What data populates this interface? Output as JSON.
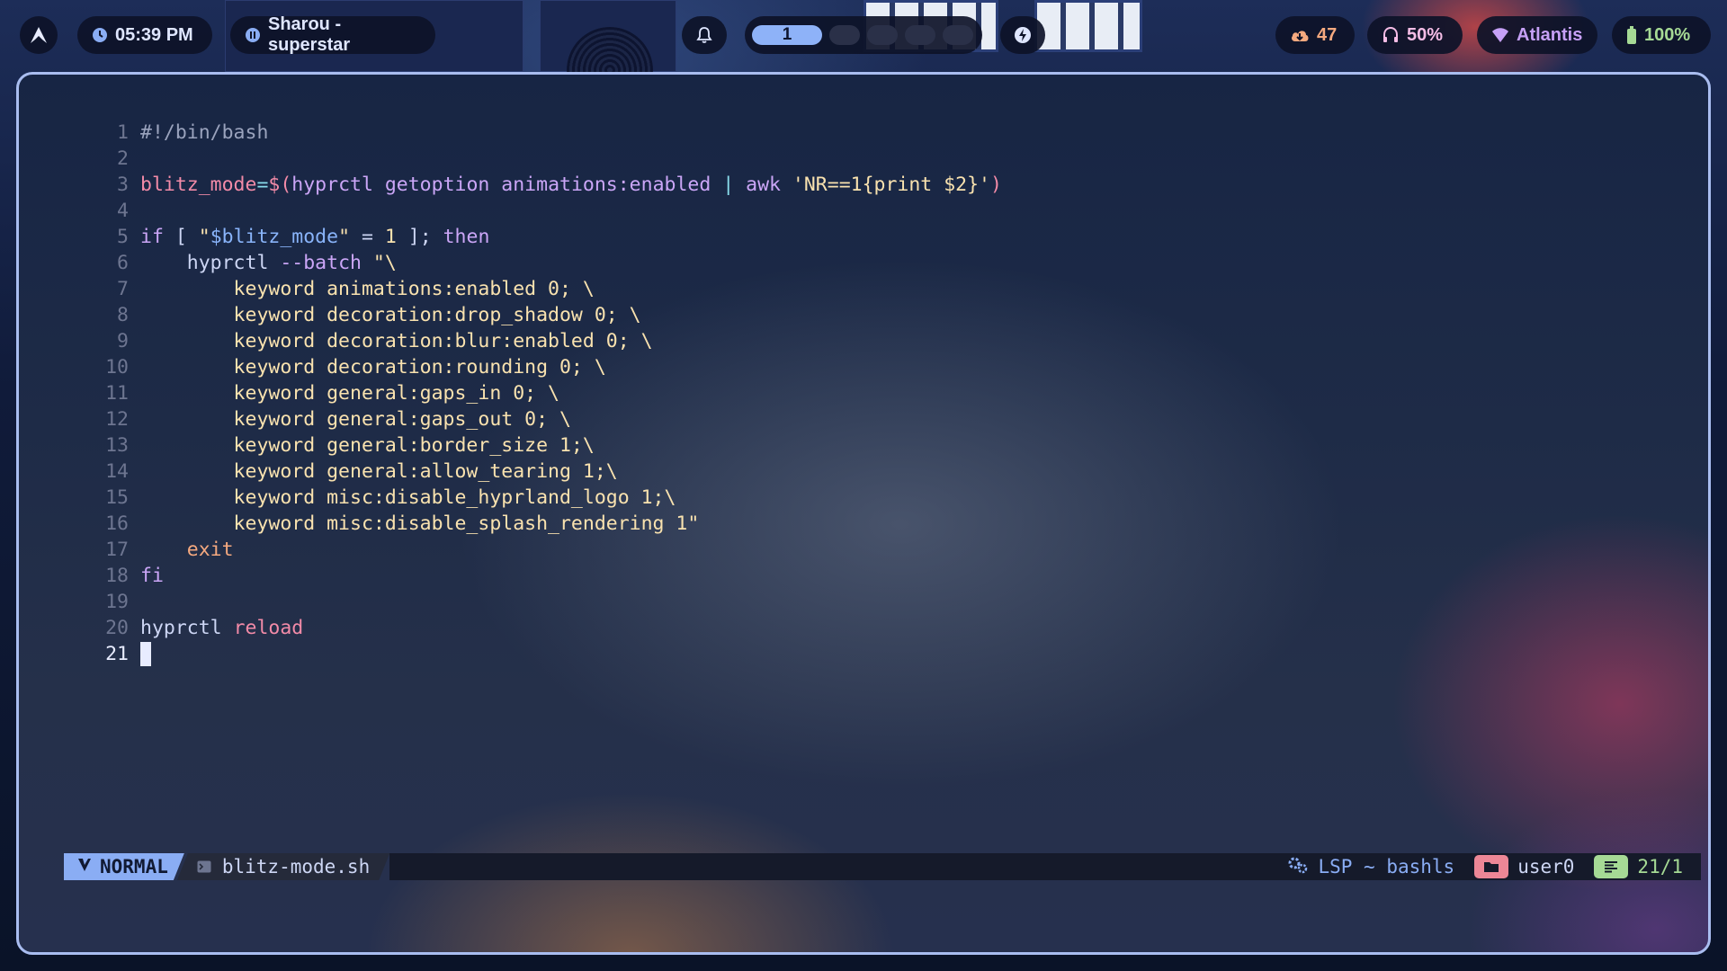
{
  "topbar": {
    "clock": "05:39 PM",
    "media": "Sharou - superstar",
    "workspace_active": "1",
    "updates": "47",
    "volume": "50%",
    "network": "Atlantis",
    "battery": "100%"
  },
  "editor": {
    "lines": [
      {
        "n": "1",
        "parts": [
          {
            "c": "t-cmt",
            "t": "#!/bin/bash"
          }
        ]
      },
      {
        "n": "2",
        "parts": []
      },
      {
        "n": "3",
        "parts": [
          {
            "c": "t-var",
            "t": "blitz_mode"
          },
          {
            "c": "t-op",
            "t": "="
          },
          {
            "c": "t-var",
            "t": "$("
          },
          {
            "c": "t-kw",
            "t": "hyprctl getoption animations:enabled "
          },
          {
            "c": "t-op",
            "t": "|"
          },
          {
            "c": "t-kw",
            "t": " awk "
          },
          {
            "c": "t-str",
            "t": "'NR==1{print $2}'"
          },
          {
            "c": "t-var",
            "t": ")"
          }
        ]
      },
      {
        "n": "4",
        "parts": []
      },
      {
        "n": "5",
        "parts": [
          {
            "c": "t-kw",
            "t": "if"
          },
          {
            "c": "t-def",
            "t": " [ "
          },
          {
            "c": "t-str",
            "t": "\""
          },
          {
            "c": "t-strvar",
            "t": "$blitz_mode"
          },
          {
            "c": "t-str",
            "t": "\""
          },
          {
            "c": "t-def",
            "t": " = "
          },
          {
            "c": "t-str",
            "t": "1"
          },
          {
            "c": "t-def",
            "t": " ]; "
          },
          {
            "c": "t-kw",
            "t": "then"
          }
        ]
      },
      {
        "n": "6",
        "parts": [
          {
            "c": "t-def",
            "t": "    hyprctl "
          },
          {
            "c": "t-kw",
            "t": "--batch"
          },
          {
            "c": "t-str",
            "t": " \"\\"
          }
        ]
      },
      {
        "n": "7",
        "parts": [
          {
            "c": "t-str",
            "t": "        keyword animations:enabled 0; \\"
          }
        ]
      },
      {
        "n": "8",
        "parts": [
          {
            "c": "t-str",
            "t": "        keyword decoration:drop_shadow 0; \\"
          }
        ]
      },
      {
        "n": "9",
        "parts": [
          {
            "c": "t-str",
            "t": "        keyword decoration:blur:enabled 0; \\"
          }
        ]
      },
      {
        "n": "10",
        "parts": [
          {
            "c": "t-str",
            "t": "        keyword decoration:rounding 0; \\"
          }
        ]
      },
      {
        "n": "11",
        "parts": [
          {
            "c": "t-str",
            "t": "        keyword general:gaps_in 0; \\"
          }
        ]
      },
      {
        "n": "12",
        "parts": [
          {
            "c": "t-str",
            "t": "        keyword general:gaps_out 0; \\"
          }
        ]
      },
      {
        "n": "13",
        "parts": [
          {
            "c": "t-str",
            "t": "        keyword general:border_size 1;\\"
          }
        ]
      },
      {
        "n": "14",
        "parts": [
          {
            "c": "t-str",
            "t": "        keyword general:allow_tearing 1;\\"
          }
        ]
      },
      {
        "n": "15",
        "parts": [
          {
            "c": "t-str",
            "t": "        keyword misc:disable_hyprland_logo 1;\\"
          }
        ]
      },
      {
        "n": "16",
        "parts": [
          {
            "c": "t-str",
            "t": "        keyword misc:disable_splash_rendering 1\""
          }
        ]
      },
      {
        "n": "17",
        "parts": [
          {
            "c": "t-exit",
            "t": "    exit"
          }
        ]
      },
      {
        "n": "18",
        "parts": [
          {
            "c": "t-kw",
            "t": "fi"
          }
        ]
      },
      {
        "n": "19",
        "parts": []
      },
      {
        "n": "20",
        "parts": [
          {
            "c": "t-plain",
            "t": "hyprctl "
          },
          {
            "c": "t-pink",
            "t": "reload"
          }
        ]
      },
      {
        "n": "21",
        "parts": [],
        "current": true
      }
    ]
  },
  "statusline": {
    "mode": "NORMAL",
    "filename": "blitz-mode.sh",
    "lsp": "LSP ~ bashls",
    "user": "user0",
    "position": "21/1"
  },
  "colors": {
    "accent": "#8aadf4",
    "bar_bg": "#0d1228"
  }
}
